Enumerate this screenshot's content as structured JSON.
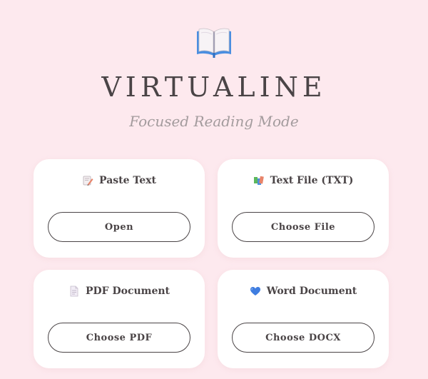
{
  "app": {
    "title": "VIRTUALINE",
    "subtitle": "Focused Reading Mode",
    "logo_icon": "open-book-icon"
  },
  "cards": [
    {
      "title": "Paste Text",
      "icon": "memo-pencil-icon",
      "button_label": "Open"
    },
    {
      "title": "Text File (TXT)",
      "icon": "books-icon",
      "button_label": "Choose File"
    },
    {
      "title": "PDF Document",
      "icon": "page-icon",
      "button_label": "Choose PDF"
    },
    {
      "title": "Word Document",
      "icon": "blue-heart-icon",
      "button_label": "Choose DOCX"
    }
  ],
  "colors": {
    "background": "#fde9ee",
    "card": "#ffffff",
    "text": "#4a4446",
    "subtitle": "#a39b9d"
  }
}
